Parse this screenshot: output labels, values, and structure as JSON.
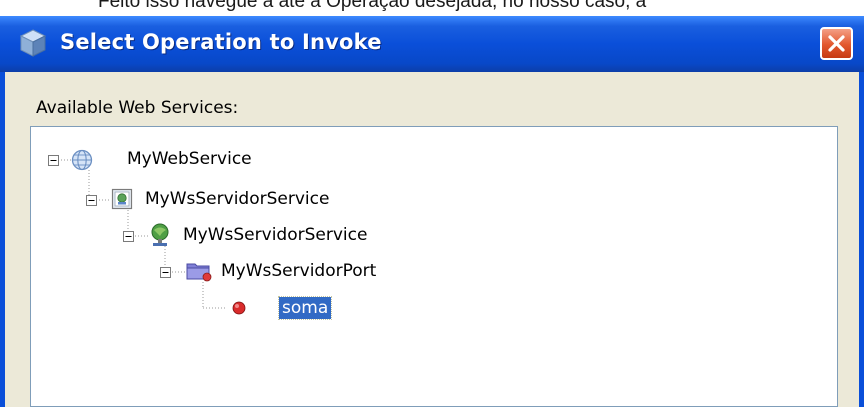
{
  "document": {
    "text": "Feito isso navegue a até a Operação desejada, no nosso caso, a"
  },
  "dialog": {
    "title": "Select Operation to Invoke",
    "services_label": "Available Web Services:"
  },
  "tree": {
    "nodes": [
      {
        "label": "MyWebService",
        "icon": "globe-icon",
        "expanded": true
      },
      {
        "label": "MyWsServidorService",
        "icon": "service-icon",
        "expanded": true
      },
      {
        "label": "MyWsServidorService",
        "icon": "service-endpoint-icon",
        "expanded": true
      },
      {
        "label": "MyWsServidorPort",
        "icon": "port-folder-icon",
        "expanded": true
      },
      {
        "label": "soma",
        "icon": "operation-icon",
        "selected": true
      }
    ]
  },
  "colors": {
    "titlebar": "#0a4fd9",
    "close_button": "#e2572d",
    "selection": "#316ac5",
    "dialog_bg": "#ece9d8"
  }
}
